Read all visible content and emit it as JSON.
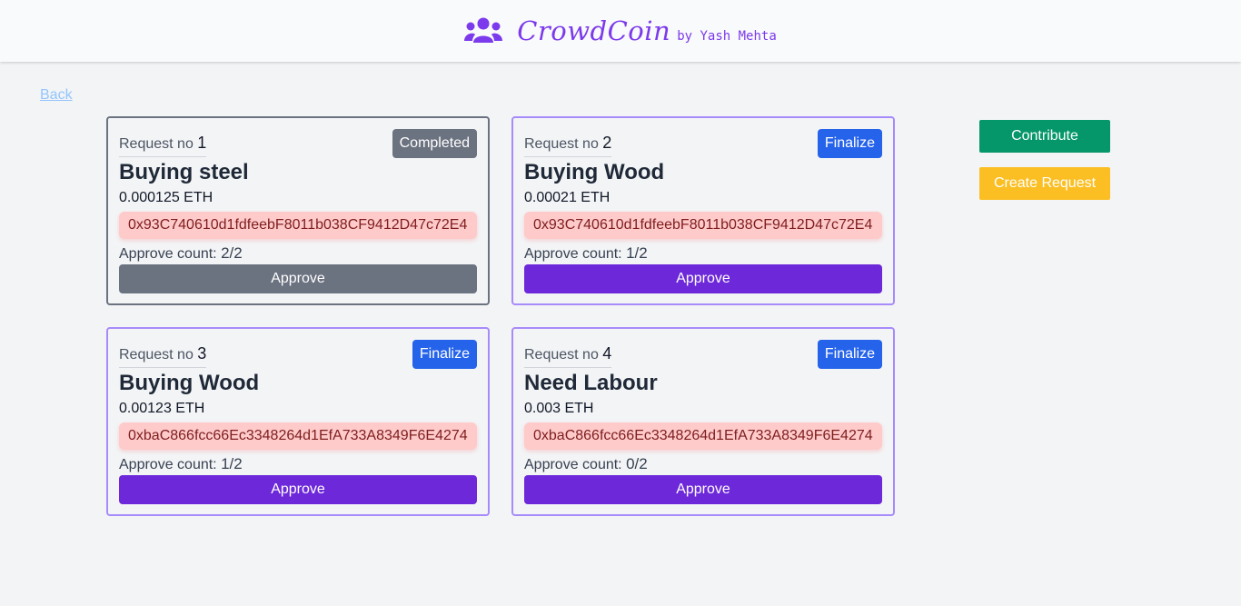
{
  "header": {
    "brand_name": "CrowdCoin",
    "brand_by": "by Yash Mehta",
    "brand_icon": "users-icon",
    "accent_color": "#7c3aed"
  },
  "nav": {
    "back_label": "Back"
  },
  "requests": [
    {
      "label": "Request no",
      "number": "1",
      "status_label": "Completed",
      "title": "Buying steel",
      "amount": "0.000125 ETH",
      "recipient": "0x93C740610d1fdfeebF8011b038CF9412D47c72E4",
      "approve_label": "Approve count:",
      "approve_count": "2/2",
      "approve_button": "Approve",
      "completed": true
    },
    {
      "label": "Request no",
      "number": "2",
      "status_label": "Finalize",
      "title": "Buying Wood",
      "amount": "0.00021 ETH",
      "recipient": "0x93C740610d1fdfeebF8011b038CF9412D47c72E4",
      "approve_label": "Approve count:",
      "approve_count": "1/2",
      "approve_button": "Approve",
      "completed": false
    },
    {
      "label": "Request no",
      "number": "3",
      "status_label": "Finalize",
      "title": "Buying Wood",
      "amount": "0.00123 ETH",
      "recipient": "0xbaC866fcc66Ec3348264d1EfA733A8349F6E4274",
      "approve_label": "Approve count:",
      "approve_count": "1/2",
      "approve_button": "Approve",
      "completed": false
    },
    {
      "label": "Request no",
      "number": "4",
      "status_label": "Finalize",
      "title": "Need Labour",
      "amount": "0.003 ETH",
      "recipient": "0xbaC866fcc66Ec3348264d1EfA733A8349F6E4274",
      "approve_label": "Approve count:",
      "approve_count": "0/2",
      "approve_button": "Approve",
      "completed": false
    }
  ],
  "actions": {
    "contribute_label": "Contribute",
    "create_request_label": "Create Request"
  }
}
